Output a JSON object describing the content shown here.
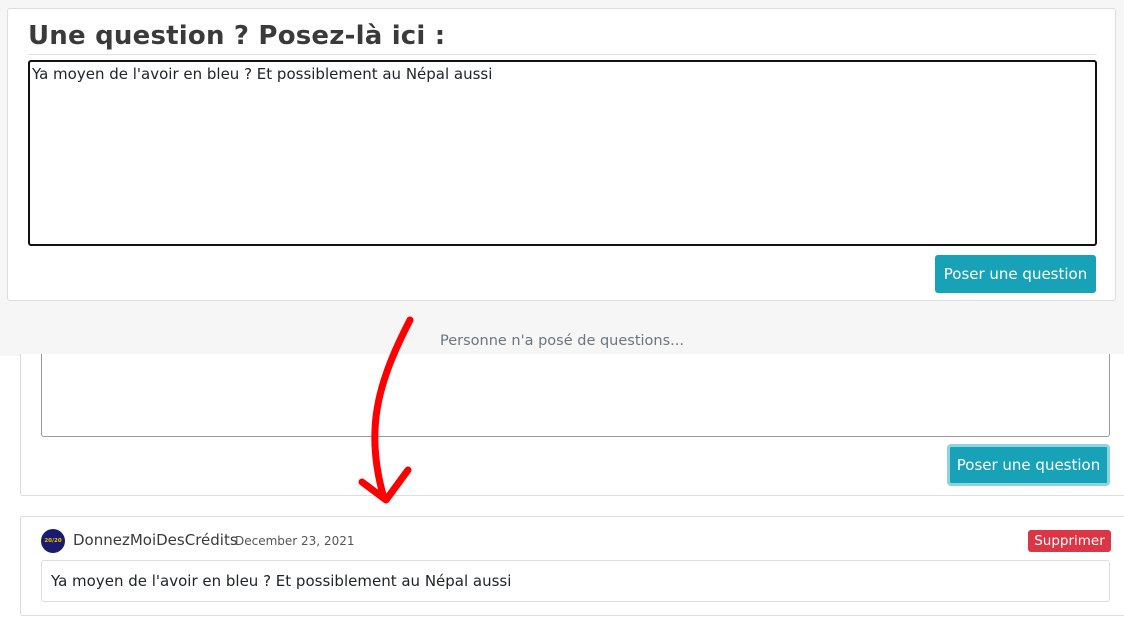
{
  "ask_form": {
    "title": "Une question ? Posez-là ici :",
    "textarea_value": "Ya moyen de l'avoir en bleu ? Et possiblement au Népal aussi",
    "submit_label": "Poser une question"
  },
  "empty_state": "Personne n'a posé de questions...",
  "after": {
    "submit_label": "Poser une question",
    "question": {
      "author": "DonnezMoiDesCrédits",
      "date": "December 23, 2021",
      "avatar_text": "20/20",
      "delete_label": "Supprimer",
      "body": "Ya moyen de l'avoir en bleu ? Et possiblement au Népal aussi"
    }
  },
  "colors": {
    "primary_button": "#17a2b8",
    "delete_button": "#dc3545",
    "annotation_arrow": "#ff0000"
  },
  "icons": {
    "arrow": "curved-down-arrow-icon"
  }
}
